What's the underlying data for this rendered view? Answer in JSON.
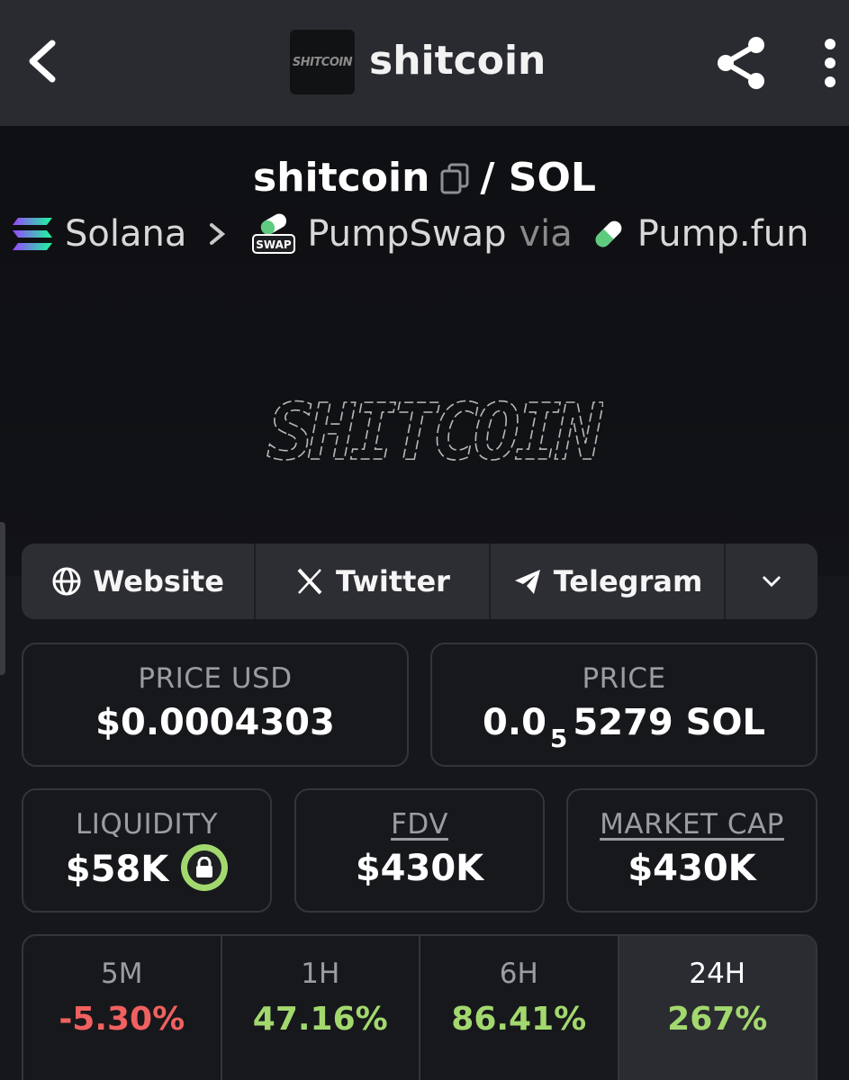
{
  "header": {
    "title": "shitcoin",
    "logo_text": "SHITCOIN"
  },
  "pair": {
    "base": "shitcoin",
    "quote": "/ SOL"
  },
  "chain": {
    "network": "Solana",
    "dex": "PumpSwap",
    "via": "via",
    "launchpad": "Pump.fun",
    "swap_badge": "SWAP"
  },
  "banner": {
    "logo_text": "SHITCOIN"
  },
  "socials": {
    "website": "Website",
    "twitter": "Twitter",
    "telegram": "Telegram"
  },
  "prices": {
    "usd_label": "PRICE USD",
    "usd_value": "$0.0004303",
    "native_label": "PRICE",
    "native_prefix": "0.0",
    "native_zeros": "5",
    "native_suffix": "5279 SOL"
  },
  "metrics": {
    "liquidity_label": "LIQUIDITY",
    "liquidity_value": "$58K",
    "fdv_label": "FDV",
    "fdv_value": "$430K",
    "mcap_label": "MARKET CAP",
    "mcap_value": "$430K"
  },
  "changes": [
    {
      "period": "5M",
      "value": "-5.30%"
    },
    {
      "period": "1H",
      "value": "47.16%"
    },
    {
      "period": "6H",
      "value": "86.41%"
    },
    {
      "period": "24H",
      "value": "267%"
    }
  ],
  "colors": {
    "positive": "#a3d86e",
    "negative": "#f0615f",
    "header_bg": "#2a2b30",
    "page_bg": "#16171c"
  }
}
